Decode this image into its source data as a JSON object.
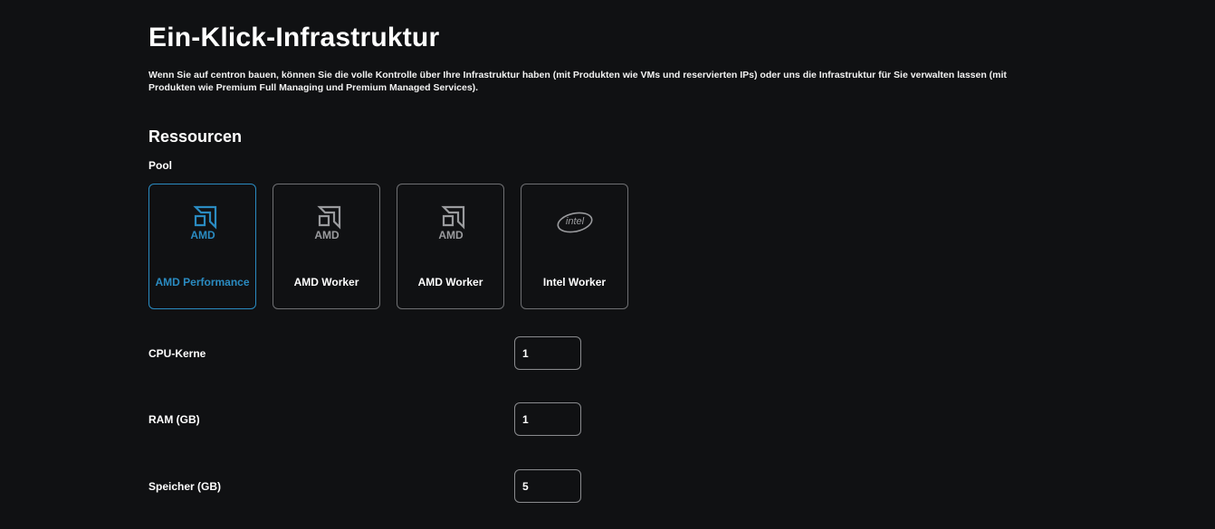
{
  "header": {
    "title": "Ein-Klick-Infrastruktur",
    "description": "Wenn Sie auf centron bauen, können Sie die volle Kontrolle über Ihre Infrastruktur haben (mit Produkten wie VMs und reservierten IPs) oder uns die Infrastruktur für Sie verwalten lassen (mit Produkten wie Premium Full Managing und Premium Managed Services)."
  },
  "resources": {
    "title": "Ressourcen",
    "pool_label": "Pool",
    "pools": [
      {
        "label": "AMD Performance",
        "logo": "amd-logo",
        "selected": true
      },
      {
        "label": "AMD Worker",
        "logo": "amd-logo",
        "selected": false
      },
      {
        "label": "AMD Worker",
        "logo": "amd-logo",
        "selected": false
      },
      {
        "label": "Intel Worker",
        "logo": "intel-logo",
        "selected": false
      }
    ],
    "fields": {
      "cpu": {
        "label": "CPU-Kerne",
        "value": "1"
      },
      "ram": {
        "label": "RAM (GB)",
        "value": "1"
      },
      "storage": {
        "label": "Speicher (GB)",
        "value": "5"
      }
    }
  },
  "colors": {
    "background": "#101113",
    "accent": "#2a8bc1",
    "border": "#6f7073",
    "logo_inactive": "#9a9b9e"
  }
}
